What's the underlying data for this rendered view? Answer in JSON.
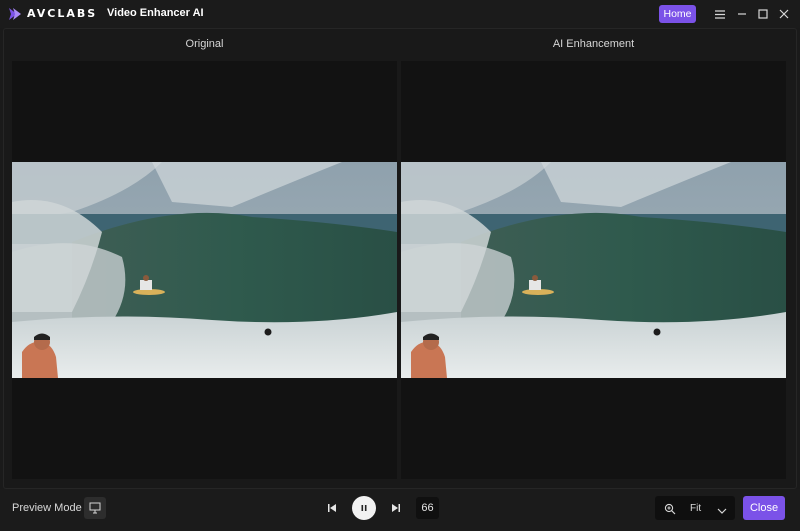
{
  "titlebar": {
    "brand": "AVCLABS",
    "app_name": "Video Enhancer AI",
    "home_label": "Home",
    "icons": [
      "menu-icon",
      "minimize-icon",
      "maximize-icon",
      "close-window-icon"
    ]
  },
  "comparison": {
    "left_label": "Original",
    "right_label": "AI Enhancement"
  },
  "bottom": {
    "preview_mode_label": "Preview Mode",
    "frame_number": "66",
    "zoom_value": "Fit",
    "close_label": "Close"
  },
  "colors": {
    "accent": "#7b52e8",
    "background": "#1a1a1a",
    "viewer": "#121212"
  }
}
